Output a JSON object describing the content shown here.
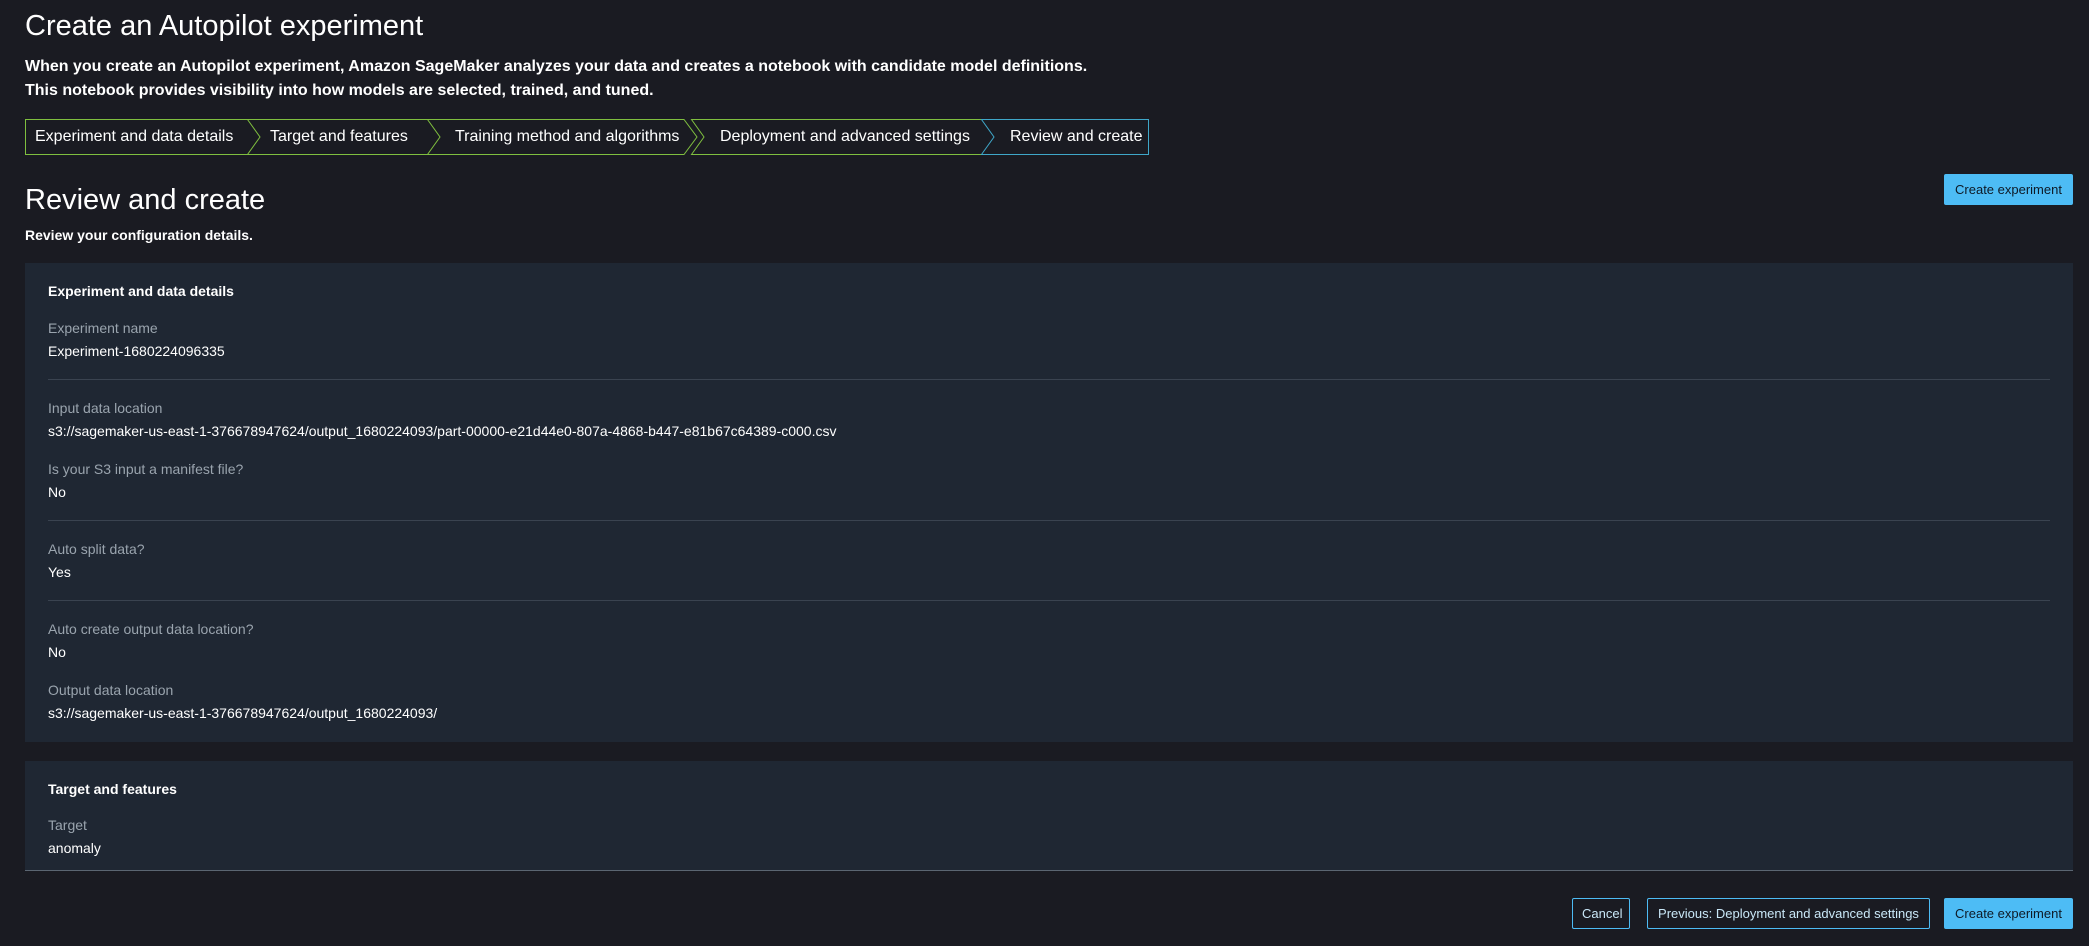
{
  "page": {
    "title": "Create an Autopilot experiment",
    "description_line1": "When you create an Autopilot experiment, Amazon SageMaker analyzes your data and creates a notebook with candidate model definitions.",
    "description_line2": "This notebook provides visibility into how models are selected, trained, and tuned."
  },
  "steps": [
    {
      "label": "Experiment and data details",
      "state": "completed"
    },
    {
      "label": "Target and features",
      "state": "completed"
    },
    {
      "label": "Training method and algorithms",
      "state": "completed"
    },
    {
      "label": "Deployment and advanced settings",
      "state": "completed"
    },
    {
      "label": "Review and create",
      "state": "current"
    }
  ],
  "review": {
    "title": "Review and create",
    "subtitle": "Review your configuration details.",
    "create_button_label": "Create experiment"
  },
  "experiment_card": {
    "heading": "Experiment and data details",
    "experiment_name_label": "Experiment name",
    "experiment_name_value": "Experiment-1680224096335",
    "input_location_label": "Input data location",
    "input_location_value": "s3://sagemaker-us-east-1-376678947624/output_1680224093/part-00000-e21d44e0-807a-4868-b447-e81b67c64389-c000.csv",
    "manifest_label": "Is your S3 input a manifest file?",
    "manifest_value": "No",
    "auto_split_label": "Auto split data?",
    "auto_split_value": "Yes",
    "auto_output_label": "Auto create output data location?",
    "auto_output_value": "No",
    "output_location_label": "Output data location",
    "output_location_value": "s3://sagemaker-us-east-1-376678947624/output_1680224093/"
  },
  "target_card": {
    "heading": "Target and features",
    "target_label": "Target",
    "target_value": "anomaly"
  },
  "footer": {
    "cancel_label": "Cancel",
    "previous_label": "Previous: Deployment and advanced settings",
    "create_label": "Create experiment"
  },
  "colors": {
    "background": "#1a1b22",
    "card": "#1f2733",
    "step_completed_border": "#7fbf3f",
    "step_current_border": "#3fa7c9",
    "primary_button": "#4dbcf5"
  }
}
